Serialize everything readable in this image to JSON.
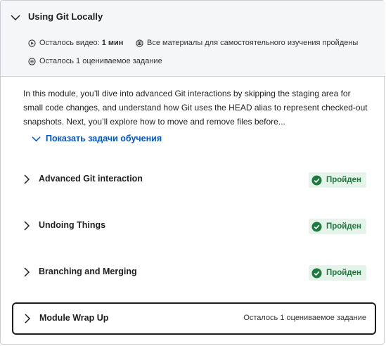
{
  "module": {
    "title": "Using Git Locally",
    "video_left_label": "Осталось видео:",
    "video_left_value": "1 мин",
    "materials_status": "Все материалы для самостоятельного изучения пройдены",
    "graded_left": "Осталось 1 оцениваемое задание"
  },
  "description": "In this module, you’ll dive into advanced Git interactions by skipping the staging area for small code changes, and understand how Git uses the HEAD alias to represent checked-out snapshots. Next, you’ll explore how to move and remove files before...",
  "show_objectives_label": "Показать задачи обучения",
  "lessons": [
    {
      "title": "Advanced Git interaction",
      "status": "Пройден"
    },
    {
      "title": "Undoing Things",
      "status": "Пройден"
    },
    {
      "title": "Branching and Merging",
      "status": "Пройден"
    },
    {
      "title": "Module Wrap Up",
      "status": "Осталось 1 оцениваемое задание"
    }
  ],
  "colors": {
    "accent": "#0056d2",
    "success": "#1d7a3d",
    "success_bg": "#e6f3ea",
    "header_bg": "#f5f6f7"
  },
  "icons": [
    "chevron-down-icon",
    "play-circle-icon",
    "reading-icon",
    "quiz-icon",
    "chevron-right-icon",
    "check-circle-icon"
  ]
}
